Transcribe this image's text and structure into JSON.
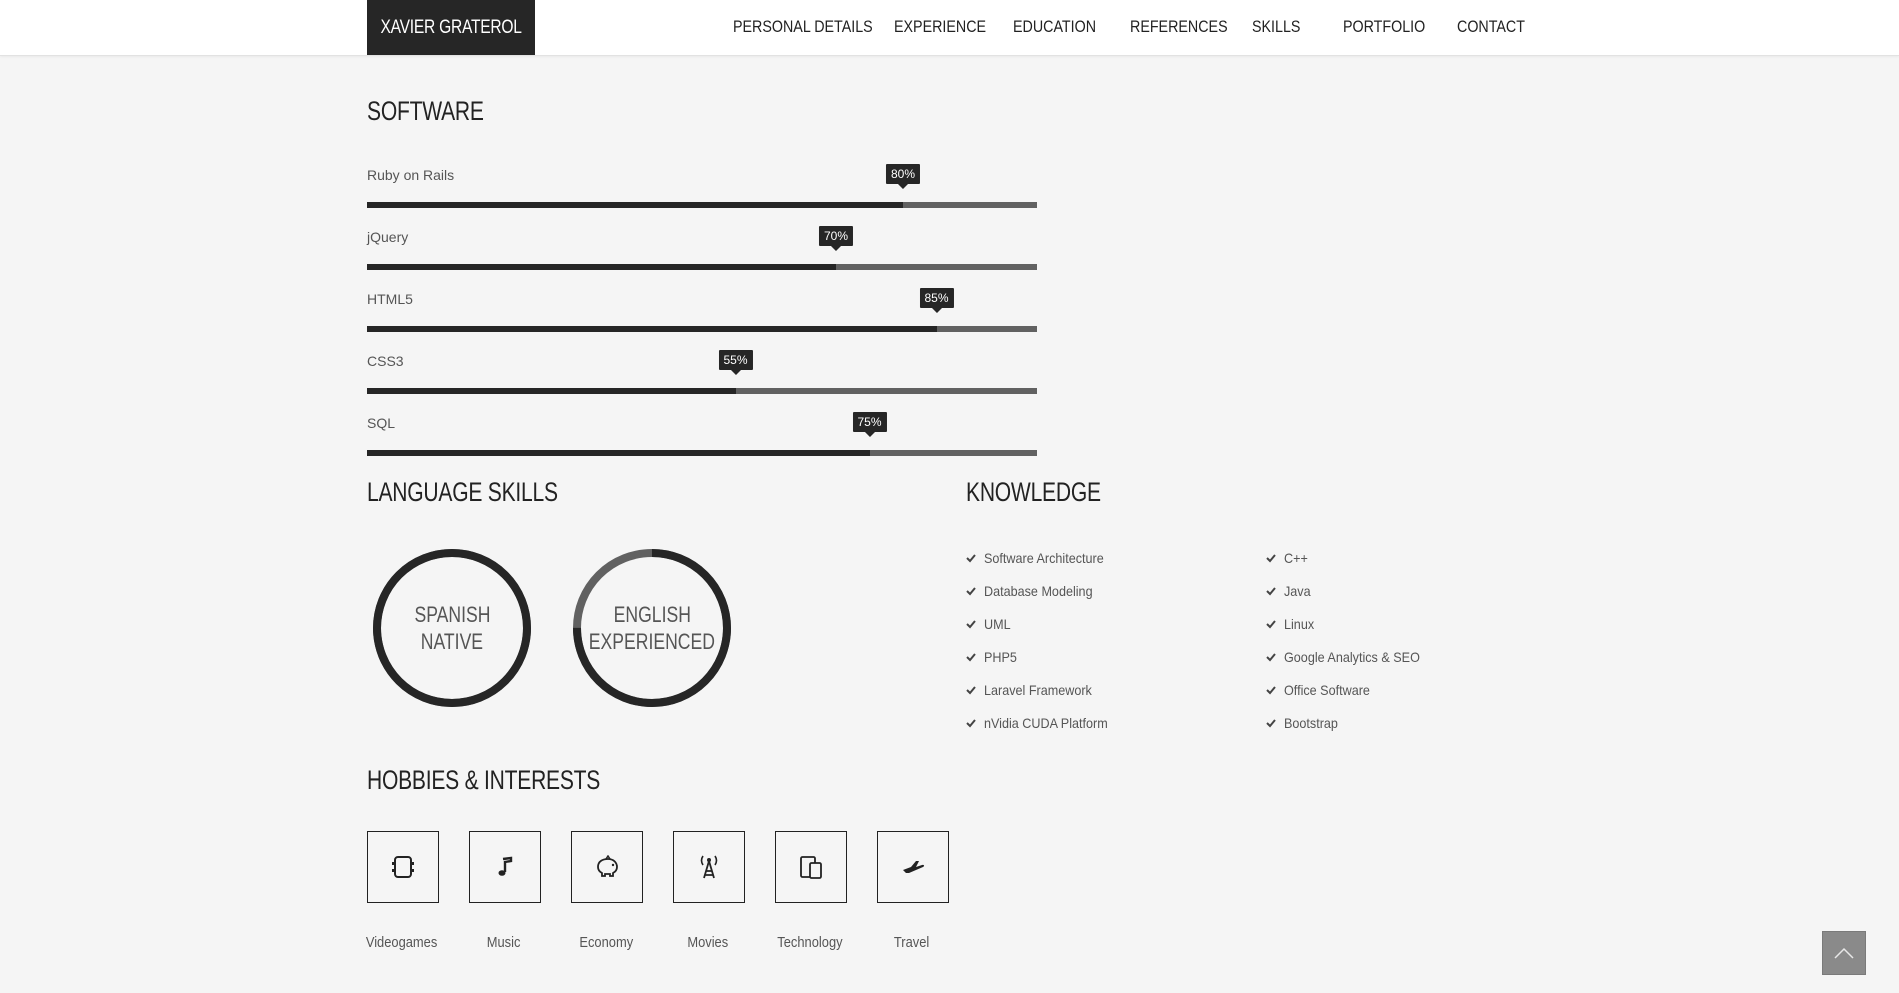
{
  "nav": {
    "brand": "XAVIER GRATEROL",
    "items": [
      "PERSONAL DETAILS",
      "EXPERIENCE",
      "EDUCATION",
      "REFERENCES",
      "SKILLS",
      "PORTFOLIO",
      "CONTACT"
    ]
  },
  "software": {
    "title": "SOFTWARE",
    "skills": [
      {
        "name": "Ruby on Rails",
        "percent": 80,
        "label": "80%"
      },
      {
        "name": "jQuery",
        "percent": 70,
        "label": "70%"
      },
      {
        "name": "HTML5",
        "percent": 85,
        "label": "85%"
      },
      {
        "name": "CSS3",
        "percent": 55,
        "label": "55%"
      },
      {
        "name": "SQL",
        "percent": 75,
        "label": "75%"
      }
    ]
  },
  "languages": {
    "title": "LANGUAGE SKILLS",
    "items": [
      {
        "line1": "SPANISH",
        "line2": "NATIVE",
        "percent": 100
      },
      {
        "line1": "ENGLISH",
        "line2": "EXPERIENCED",
        "percent": 75
      }
    ]
  },
  "knowledge": {
    "title": "KNOWLEDGE",
    "col1": [
      "Software Architecture",
      "Database Modeling",
      "UML",
      "PHP5",
      "Laravel Framework",
      "nVidia CUDA Platform"
    ],
    "col2": [
      "C++",
      "Java",
      "Linux",
      "Google Analytics & SEO",
      "Office Software",
      "Bootstrap"
    ]
  },
  "hobbies": {
    "title": "HOBBIES & INTERESTS",
    "items": [
      {
        "label": "Videogames",
        "icon": "gamepad-icon"
      },
      {
        "label": "Music",
        "icon": "music-note-icon"
      },
      {
        "label": "Economy",
        "icon": "piggy-bank-icon"
      },
      {
        "label": "Movies",
        "icon": "antenna-tower-icon"
      },
      {
        "label": "Technology",
        "icon": "devices-icon"
      },
      {
        "label": "Travel",
        "icon": "airplane-icon"
      }
    ]
  },
  "colors": {
    "dark": "#262626",
    "track": "#616161",
    "background": "#f5f5f5"
  }
}
